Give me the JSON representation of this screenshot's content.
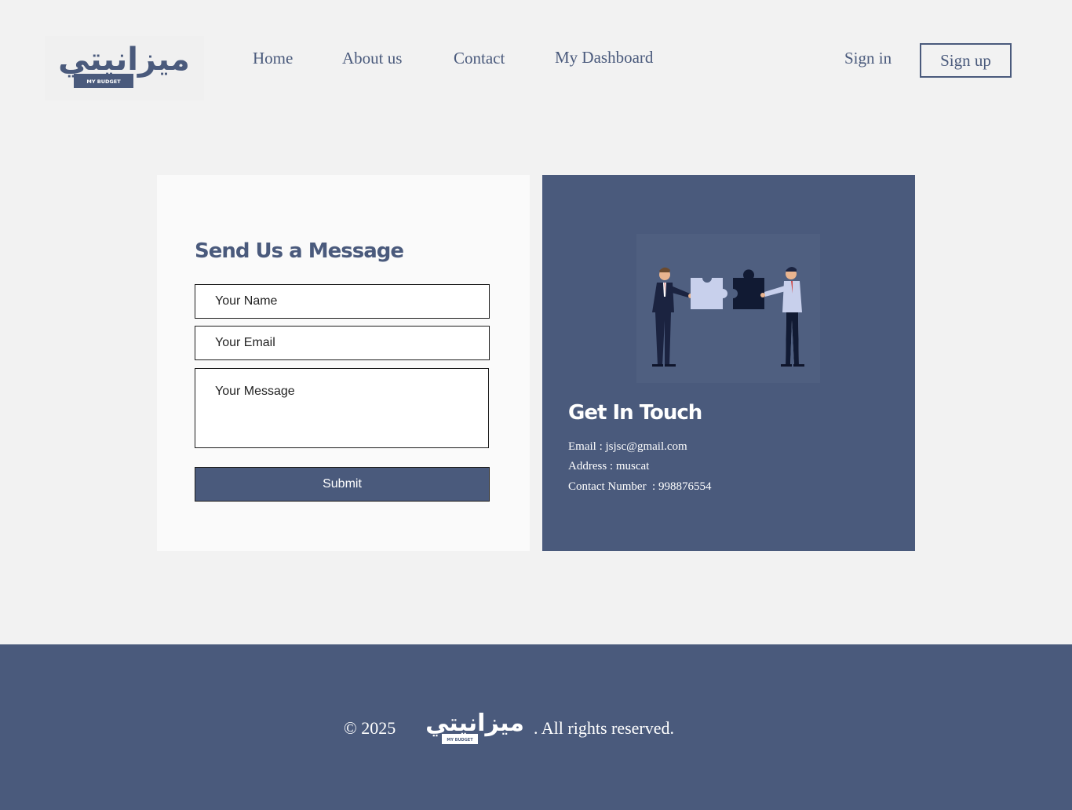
{
  "header": {
    "logo": {
      "alt": "Mizaniyati logo",
      "arabic_text": "ميزانيتي",
      "subtitle": "MY BUDGET"
    },
    "nav": [
      {
        "label": "Home"
      },
      {
        "label": "About us"
      },
      {
        "label": "Contact"
      },
      {
        "label": "My Dashboard"
      }
    ],
    "sign_in": "Sign in",
    "sign_up": "Sign up"
  },
  "contact_form": {
    "title": "Send Us a Message",
    "name_placeholder": "Your Name",
    "email_placeholder": "Your Email",
    "message_placeholder": "Your Message",
    "submit_label": "Submit"
  },
  "get_in_touch": {
    "title": "Get In Touch",
    "email": "Email : jsjsc@gmail.com",
    "address": "Address : muscat",
    "phone": "Contact Number  : 998876554"
  },
  "footer": {
    "copyright": "© 2025",
    "rights": ". All rights reserved."
  },
  "colors": {
    "brand": "#4a5a7c",
    "background": "#f2f2f2",
    "card": "#fafafa",
    "text_light": "#ffffff"
  }
}
